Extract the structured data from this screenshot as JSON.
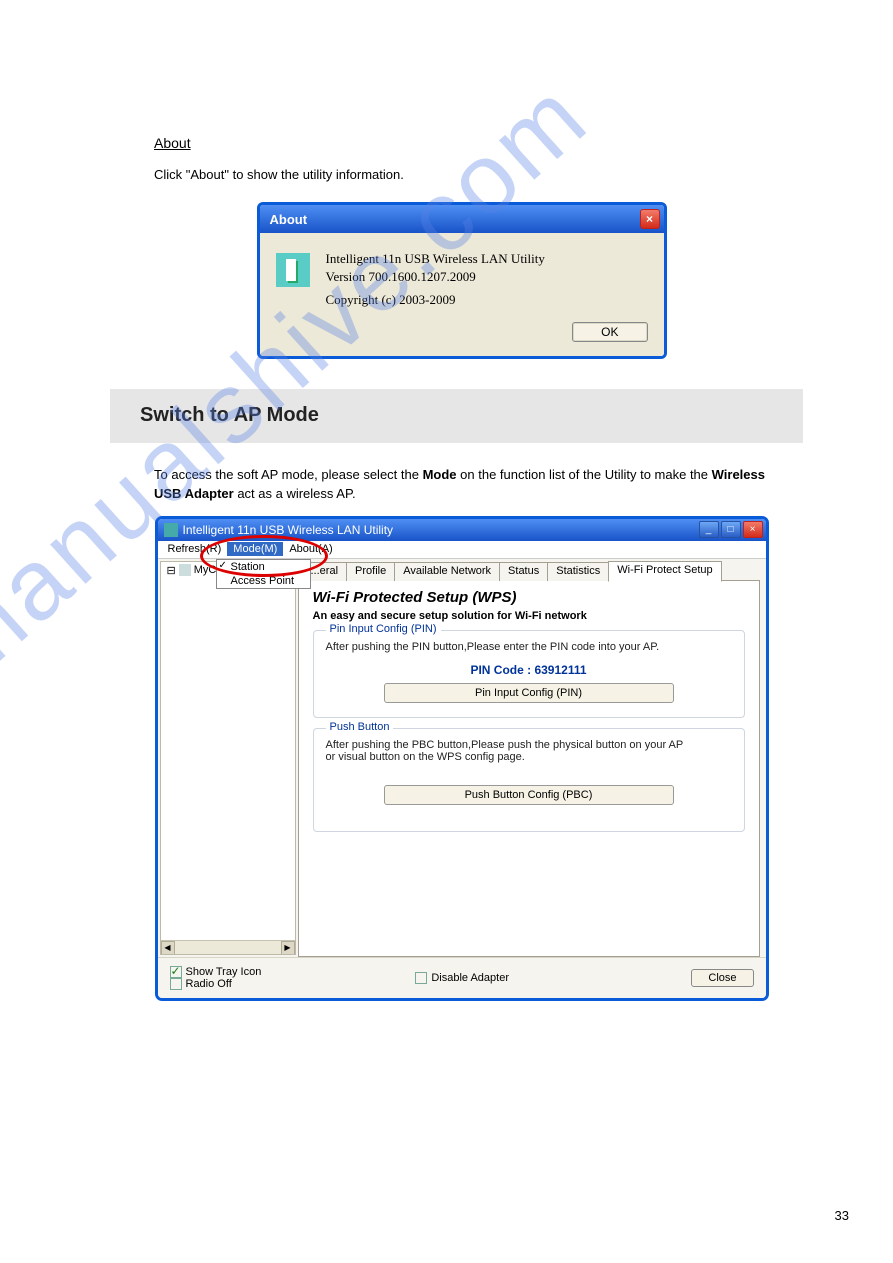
{
  "about_heading": "About",
  "about_desc": "Click \"About\" to show the utility information.",
  "about_dialog": {
    "title": "About",
    "line1": "Intelligent 11n USB Wireless LAN Utility",
    "line2": "Version 700.1600.1207.2009",
    "line3": "Copyright (c) 2003-2009",
    "ok": "OK"
  },
  "section_title": "Switch to AP Mode",
  "intro_pre": "To access the soft AP mode, please select the ",
  "intro_bold1": "Mode",
  "intro_mid": " on the function list of the Utility to make the ",
  "intro_bold2": "Wireless USB Adapter",
  "intro_post": " act as a wireless AP.",
  "utility": {
    "title": "Intelligent 11n USB Wireless LAN Utility",
    "menu": {
      "refresh": "Refresh(R)",
      "mode": "Mode(M)",
      "about": "About(A)"
    },
    "dropdown": {
      "station": "Station",
      "ap": "Access Point"
    },
    "tree_node": "MyC",
    "tabs": {
      "general": "...eral",
      "profile": "Profile",
      "available": "Available Network",
      "status": "Status",
      "statistics": "Statistics",
      "wps": "Wi-Fi Protect Setup"
    },
    "wps": {
      "heading": "Wi-Fi Protected Setup (WPS)",
      "sub": "An easy and secure setup solution for Wi-Fi network",
      "pin_legend": "Pin Input Config (PIN)",
      "pin_text": "After pushing the PIN button,Please enter the PIN code into your AP.",
      "pin_label": "PIN Code :  63912111",
      "pin_btn": "Pin Input Config (PIN)",
      "push_legend": "Push Button",
      "push_text1": "After pushing the PBC button,Please push the physical button on your AP",
      "push_text2": "or visual button on the WPS config page.",
      "pbc_btn": "Push Button Config (PBC)"
    },
    "show_tray": "Show Tray Icon",
    "radio_off": "Radio Off",
    "disable_adapter": "Disable Adapter",
    "close": "Close"
  },
  "watermark": "manualshive.com",
  "page_number": "33"
}
